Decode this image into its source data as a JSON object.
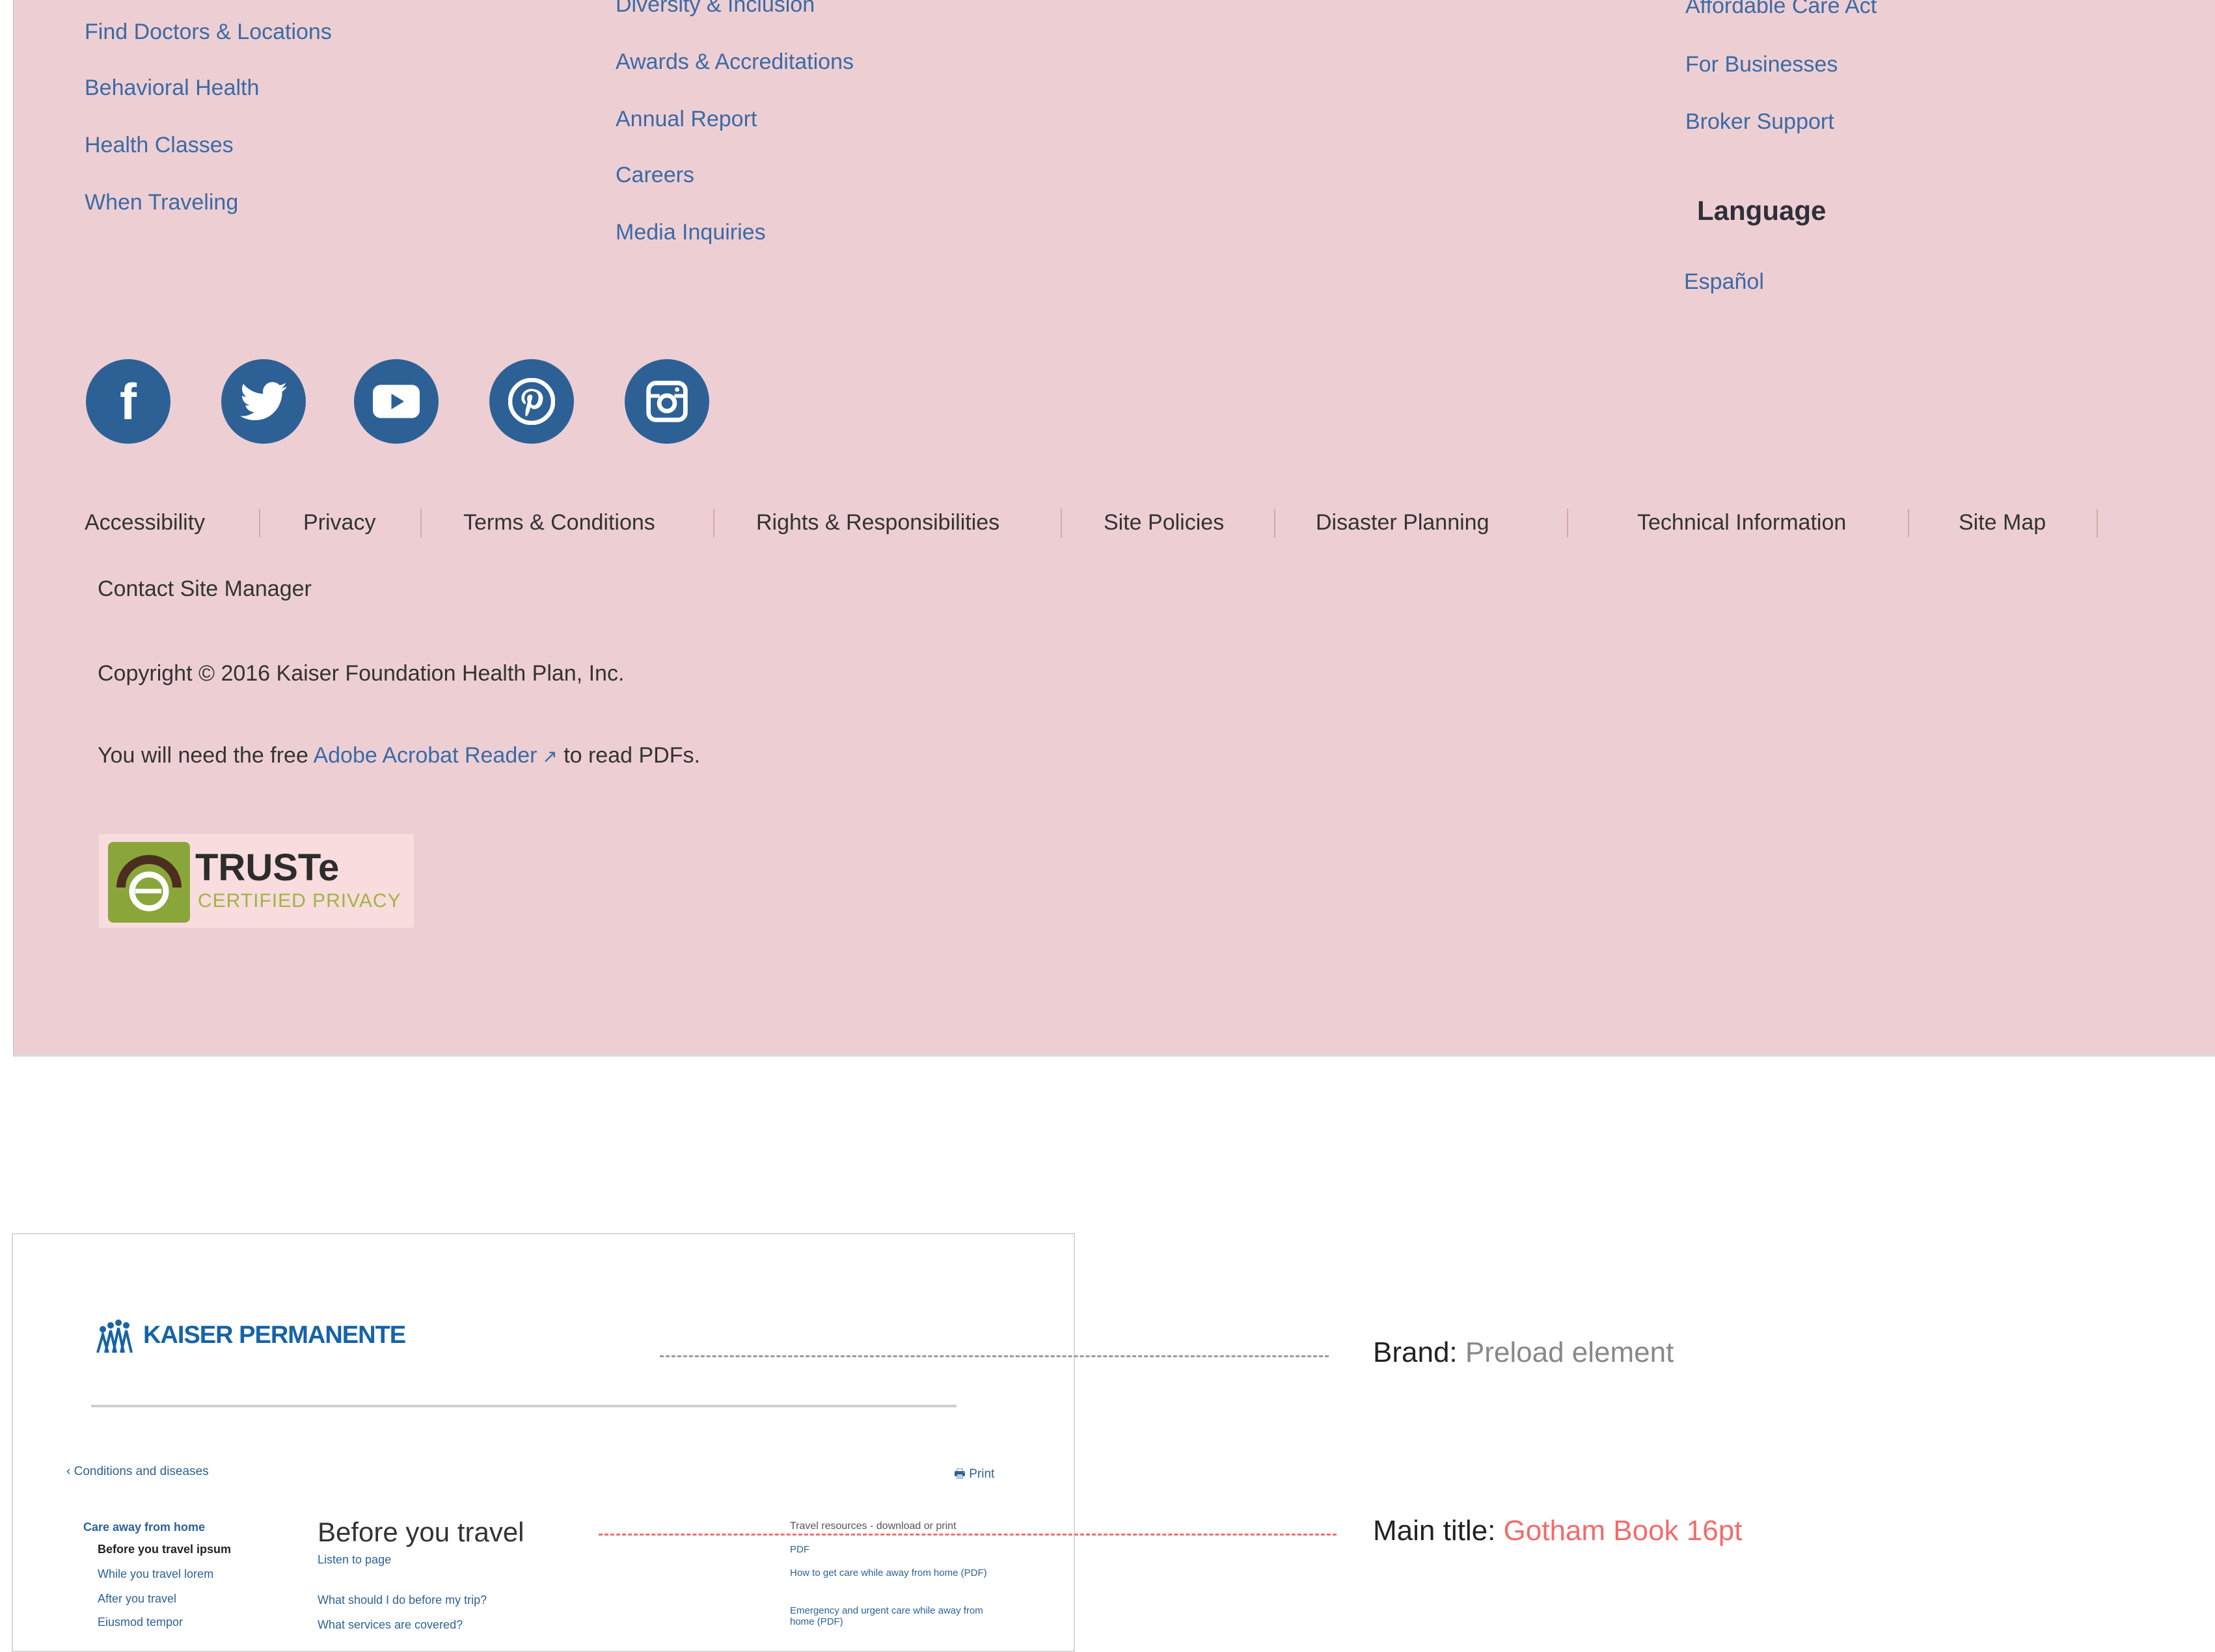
{
  "footer": {
    "col1": [
      "Find Doctors & Locations",
      "Behavioral Health",
      "Health Classes",
      "When Traveling"
    ],
    "col2": [
      "Diversity & Inclusion",
      "Awards & Accreditations",
      "Annual Report",
      "Careers",
      "Media Inquiries"
    ],
    "col3": [
      "Affordable Care Act",
      "For Businesses",
      "Broker Support"
    ],
    "language_heading": "Language",
    "language_link": "Español",
    "social": [
      "facebook-icon",
      "twitter-icon",
      "youtube-icon",
      "pinterest-icon",
      "instagram-icon"
    ],
    "legal_links": [
      "Accessibility",
      "Privacy",
      "Terms & Conditions",
      "Rights & Responsibilities",
      "Site Policies",
      "Disaster Planning",
      "Technical Information",
      "Site Map"
    ],
    "contact_link": "Contact Site Manager",
    "copyright": "Copyright © 2016 Kaiser Foundation Health Plan, Inc.",
    "acrobat_pre": "You will need the free",
    "acrobat_link": "Adobe Acrobat Reader",
    "acrobat_post": "to read PDFs.",
    "truste_title": "TRUSTe",
    "truste_sub": "CERTIFIED PRIVACY"
  },
  "preview": {
    "brand": "KAISER PERMANENTE",
    "back_link": "Conditions and diseases",
    "print": "Print",
    "side_heading": "Care away from home",
    "side_items": [
      "Before you travel ipsum",
      "While you travel lorem",
      "After you travel",
      "Eiusmod tempor"
    ],
    "title": "Before you travel",
    "listen": "Listen to page",
    "q1": "What should I do before my trip?",
    "q2": "What services are covered?",
    "resources_heading": "Travel resources - download or print",
    "resources": [
      "PDF",
      "How to get care while away from home (PDF)",
      "Emergency and urgent care while away from home (PDF)"
    ]
  },
  "annotations": {
    "brand_label": "Brand:",
    "brand_value": "Preload element",
    "title_label": "Main title:",
    "title_value": "Gotham Book 16pt"
  },
  "colors": {
    "footer_bg": "#edcfd3",
    "link": "#3b6aa6",
    "social_bg": "#2d6196",
    "annotation_red": "#f36b6b",
    "annotation_gray": "#888888"
  }
}
